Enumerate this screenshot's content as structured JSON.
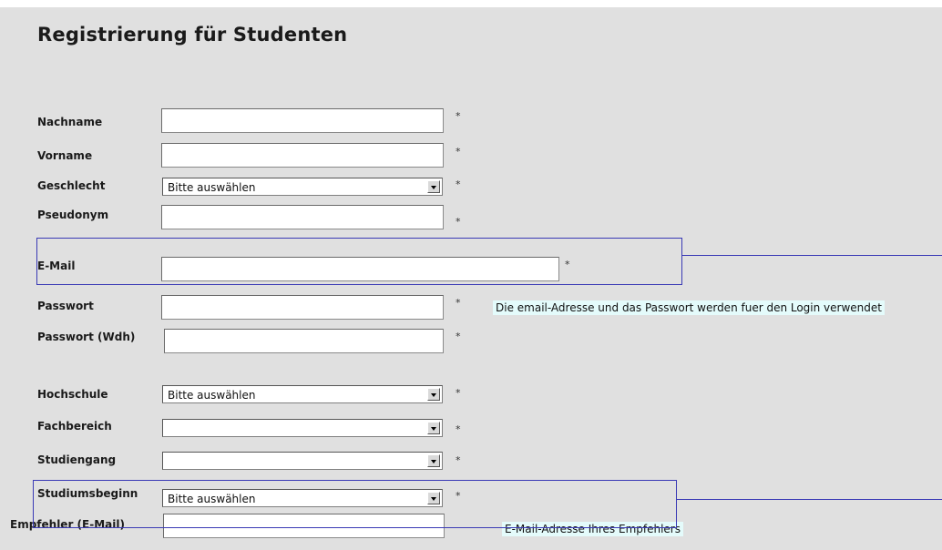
{
  "title": "Registrierung für Studenten",
  "required_marker": "*",
  "fields": {
    "nachname": {
      "label": "Nachname",
      "value": ""
    },
    "vorname": {
      "label": "Vorname",
      "value": ""
    },
    "geschlecht": {
      "label": "Geschlecht",
      "selected": "Bitte auswählen"
    },
    "pseudonym": {
      "label": "Pseudonym",
      "value": ""
    },
    "email": {
      "label": "E-Mail",
      "value": ""
    },
    "passwort": {
      "label": "Passwort",
      "value": ""
    },
    "passwort_wdh": {
      "label": "Passwort (Wdh)",
      "value": ""
    },
    "hochschule": {
      "label": "Hochschule",
      "selected": "Bitte auswählen"
    },
    "fachbereich": {
      "label": "Fachbereich",
      "selected": ""
    },
    "studiengang": {
      "label": "Studiengang",
      "selected": ""
    },
    "studiumsbeginn": {
      "label": "Studiumsbeginn",
      "selected": "Bitte auswählen"
    },
    "empfehler": {
      "label": "Empfehler (E-Mail)",
      "value": ""
    }
  },
  "hints": {
    "login": "Die email-Adresse und das Passwort werden fuer den Login verwendet",
    "empfehler": "E-Mail-Adresse Ihres Empfehlers"
  },
  "colors": {
    "background": "#e0e0e0",
    "hint_background": "#e4fbfb",
    "annotation_box": "#3a3ab5"
  }
}
